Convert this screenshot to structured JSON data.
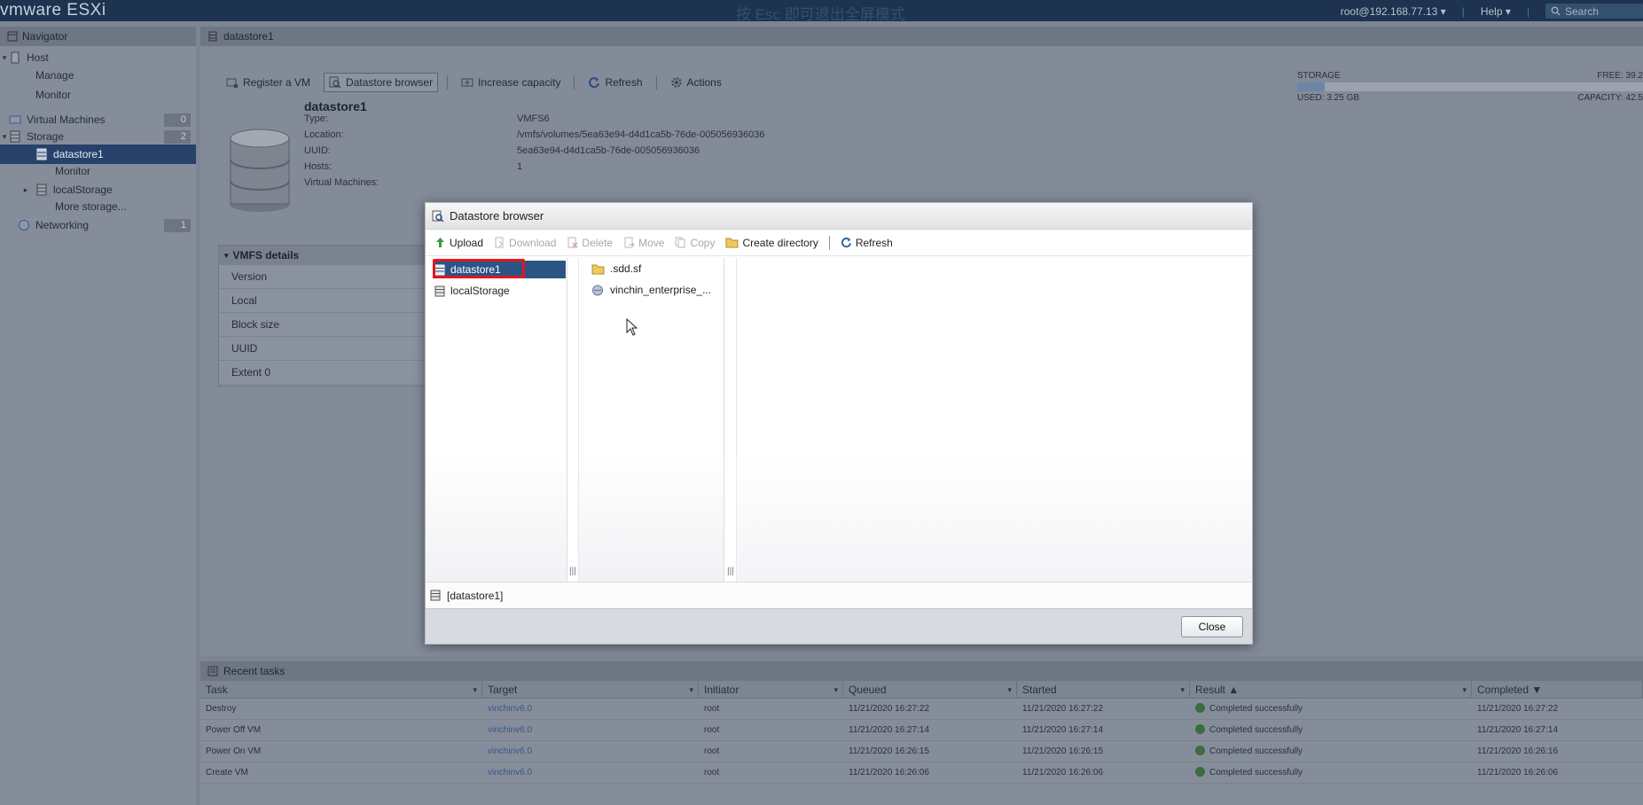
{
  "topbar": {
    "brand_vm": "vm",
    "brand_ware": "ware",
    "brand_product": "ESXi",
    "fullscreen_hint": "按 Esc 即可退出全屏模式",
    "user": "root@192.168.77.13",
    "help": "Help",
    "search_placeholder": "Search"
  },
  "navigator": {
    "title": "Navigator",
    "host": "Host",
    "manage": "Manage",
    "monitor": "Monitor",
    "virtual_machines": "Virtual Machines",
    "vm_count": "0",
    "storage": "Storage",
    "storage_count": "2",
    "datastore1": "datastore1",
    "ds_monitor": "Monitor",
    "local_storage": "localStorage",
    "more_storage": "More storage...",
    "networking": "Networking",
    "networking_count": "1"
  },
  "main": {
    "header_title": "datastore1",
    "toolbar": {
      "register_vm": "Register a VM",
      "datastore_browser": "Datastore browser",
      "increase_capacity": "Increase capacity",
      "refresh": "Refresh",
      "actions": "Actions"
    },
    "datastore_name": "datastore1",
    "props": [
      {
        "k": "Type:",
        "v": "VMFS6"
      },
      {
        "k": "Location:",
        "v": "/vmfs/volumes/5ea63e94-d4d1ca5b-76de-005056936036"
      },
      {
        "k": "UUID:",
        "v": "5ea63e94-d4d1ca5b-76de-005056936036"
      },
      {
        "k": "Hosts:",
        "v": "1"
      },
      {
        "k": "Virtual Machines:",
        "v": ""
      }
    ],
    "storage": {
      "label": "STORAGE",
      "free": "FREE: 39.2",
      "used": "USED: 3.25 GB",
      "capacity": "CAPACITY: 42.5",
      "used_fraction": 0.08
    },
    "vmfs": {
      "title": "VMFS details",
      "rows": [
        "Version",
        "Local",
        "Block size",
        "UUID",
        "Extent 0"
      ]
    }
  },
  "modal": {
    "title": "Datastore browser",
    "toolbar": {
      "upload": "Upload",
      "download": "Download",
      "delete": "Delete",
      "move": "Move",
      "copy": "Copy",
      "create_directory": "Create directory",
      "refresh": "Refresh"
    },
    "tree": [
      "datastore1",
      "localStorage"
    ],
    "files": [
      ".sdd.sf",
      "vinchin_enterprise_..."
    ],
    "status_path": "[datastore1]",
    "close": "Close"
  },
  "tasks": {
    "title": "Recent tasks",
    "columns": [
      "Task",
      "Target",
      "Initiator",
      "Queued",
      "Started",
      "Result ▲",
      "Completed ▼"
    ],
    "rows": [
      {
        "task": "Destroy",
        "target": "vinchinv6.0",
        "initiator": "root",
        "queued": "11/21/2020 16:27:22",
        "started": "11/21/2020 16:27:22",
        "result": "Completed successfully",
        "completed": "11/21/2020 16:27:22"
      },
      {
        "task": "Power Off VM",
        "target": "vinchinv6.0",
        "initiator": "root",
        "queued": "11/21/2020 16:27:14",
        "started": "11/21/2020 16:27:14",
        "result": "Completed successfully",
        "completed": "11/21/2020 16:27:14"
      },
      {
        "task": "Power On VM",
        "target": "vinchinv6.0",
        "initiator": "root",
        "queued": "11/21/2020 16:26:15",
        "started": "11/21/2020 16:26:15",
        "result": "Completed successfully",
        "completed": "11/21/2020 16:26:16"
      },
      {
        "task": "Create VM",
        "target": "vinchinv6.0",
        "initiator": "root",
        "queued": "11/21/2020 16:26:06",
        "started": "11/21/2020 16:26:06",
        "result": "Completed successfully",
        "completed": "11/21/2020 16:26:06"
      }
    ]
  },
  "colors": {
    "selection": "#2b5486",
    "highlight": "#e8141b",
    "topbar": "#1d3350"
  }
}
